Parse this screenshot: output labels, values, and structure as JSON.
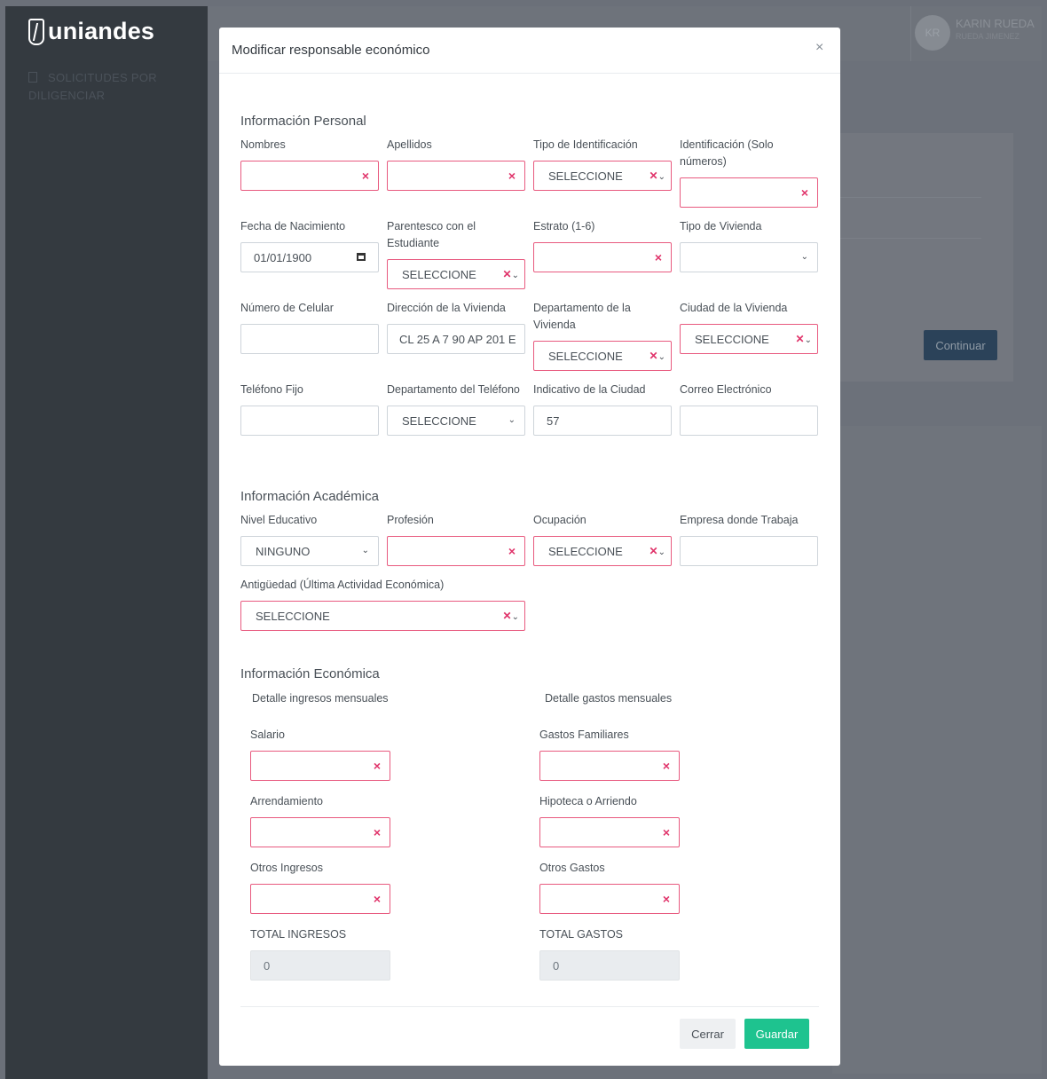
{
  "app": {
    "logo_text": "uniandes",
    "sidebar_link": "SOLICITUDES POR DILIGENCIAR",
    "user_initials": "KR",
    "user_name": "KARIN RUEDA",
    "user_sub": "RUEDA JIMENEZ",
    "continue_label": "Continuar"
  },
  "modal": {
    "title": "Modificar responsable económico",
    "close_glyph": "×",
    "personal": {
      "title": "Información Personal",
      "nombres": {
        "label": "Nombres",
        "value": ""
      },
      "apellidos": {
        "label": "Apellidos",
        "value": ""
      },
      "tipo_id": {
        "label": "Tipo de Identificación",
        "value": "SELECCIONE"
      },
      "identificacion": {
        "label": "Identificación (Solo números)",
        "value": ""
      },
      "fecha_nac": {
        "label": "Fecha de Nacimiento",
        "value": "01/01/1900"
      },
      "parentesco": {
        "label": "Parentesco con el Estudiante",
        "value": "SELECCIONE"
      },
      "estrato": {
        "label": "Estrato (1-6)",
        "value": ""
      },
      "tipo_vivienda": {
        "label": "Tipo de Vivienda",
        "value": ""
      },
      "celular": {
        "label": "Número de Celular",
        "value": ""
      },
      "direccion": {
        "label": "Dirección de la Vivienda",
        "value": "CL 25 A 7 90 AP 201 E"
      },
      "depto_vivienda": {
        "label": "Departamento de la Vivienda",
        "value": "SELECCIONE"
      },
      "ciudad_vivienda": {
        "label": "Ciudad de la Vivienda",
        "value": "SELECCIONE"
      },
      "telefono_fijo": {
        "label": "Teléfono Fijo",
        "value": ""
      },
      "depto_telefono": {
        "label": "Departamento del Teléfono",
        "value": "SELECCIONE"
      },
      "indicativo": {
        "label": "Indicativo de la Ciudad",
        "value": "57"
      },
      "correo": {
        "label": "Correo Electrónico",
        "value": ""
      }
    },
    "academic": {
      "title": "Información Académica",
      "nivel": {
        "label": "Nivel Educativo",
        "value": "NINGUNO"
      },
      "profesion": {
        "label": "Profesión",
        "value": ""
      },
      "ocupacion": {
        "label": "Ocupación",
        "value": "SELECCIONE"
      },
      "empresa": {
        "label": "Empresa donde Trabaja",
        "value": ""
      },
      "antiguedad": {
        "label": "Antigüedad (Última Actividad Económica)",
        "value": "SELECCIONE"
      }
    },
    "economic": {
      "title": "Información Económica",
      "ingresos_header": "Detalle ingresos mensuales",
      "gastos_header": "Detalle gastos mensuales",
      "salario": {
        "label": "Salario",
        "value": ""
      },
      "gastos_familiares": {
        "label": "Gastos Familiares",
        "value": ""
      },
      "arrendamiento": {
        "label": "Arrendamiento",
        "value": ""
      },
      "hipoteca": {
        "label": "Hipoteca o Arriendo",
        "value": ""
      },
      "otros_ingresos": {
        "label": "Otros Ingresos",
        "value": ""
      },
      "otros_gastos": {
        "label": "Otros Gastos",
        "value": ""
      },
      "total_ingresos": {
        "label": "TOTAL INGRESOS",
        "value": "0"
      },
      "total_gastos": {
        "label": "TOTAL GASTOS",
        "value": "0"
      }
    },
    "buttons": {
      "close": "Cerrar",
      "save": "Guardar"
    }
  },
  "colors": {
    "error_border": "#e85a7f",
    "error_x": "#e0336a",
    "save_button": "#1ec38f",
    "sidebar": "#343a40"
  },
  "icons": {
    "clear": "×",
    "dropdown": "chevron-down-icon",
    "calendar": "calendar-icon",
    "close": "close-icon"
  }
}
